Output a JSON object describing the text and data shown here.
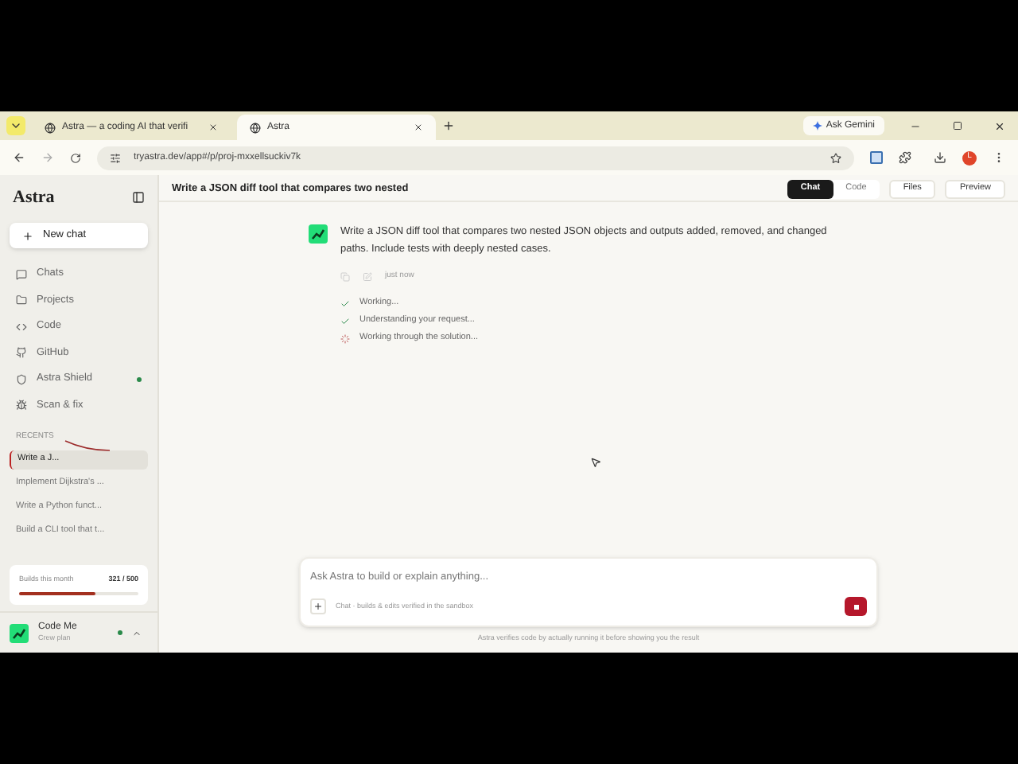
{
  "browser": {
    "tabs": [
      {
        "title": "Astra — a coding AI that verifi",
        "selected": false
      },
      {
        "title": "Astra",
        "selected": true
      }
    ],
    "ask_button": "Ask Gemini",
    "url": "tryastra.dev/app#/p/proj-mxxellsuckiv7k",
    "profile_initial": "L"
  },
  "sidebar": {
    "logo": "Astra",
    "new_chat": "New chat",
    "nav": [
      {
        "label": "Chats",
        "status_dot": false
      },
      {
        "label": "Projects",
        "status_dot": false
      },
      {
        "label": "Code",
        "status_dot": false
      },
      {
        "label": "GitHub",
        "status_dot": false
      },
      {
        "label": "Astra Shield",
        "status_dot": true
      },
      {
        "label": "Scan & fix",
        "status_dot": false
      }
    ],
    "recents_heading": "RECENTS",
    "recents": [
      {
        "label": "Write a J...",
        "selected": true
      },
      {
        "label": "Implement Dijkstra's ...",
        "selected": false
      },
      {
        "label": "Write a Python funct...",
        "selected": false
      },
      {
        "label": "Build a CLI tool that t...",
        "selected": false
      }
    ],
    "usage": {
      "label": "Builds this month",
      "count": "321 / 500",
      "level": 0.642
    },
    "user": {
      "name": "Code Me",
      "plan": "Crew plan",
      "online": true
    }
  },
  "header": {
    "title": "Write a JSON diff tool that compares two nested",
    "view_tabs": [
      {
        "label": "Chat",
        "selected": true
      },
      {
        "label": "Code",
        "selected": false
      }
    ],
    "buttons": [
      "Files",
      "Preview"
    ]
  },
  "message": {
    "text": "Write a JSON diff tool that compares two nested JSON objects and outputs added, removed, and changed paths. Include tests with deeply nested cases.",
    "time": "just now"
  },
  "steps": [
    {
      "label": "Working...",
      "kind": "done"
    },
    {
      "label": "Understanding your request...",
      "kind": "done"
    },
    {
      "label": "Working through the solution...",
      "kind": "running"
    }
  ],
  "composer": {
    "placeholder": "Ask Astra to build or explain anything...",
    "mode": "Chat · builds & edits verified in the sandbox"
  },
  "footer": "Astra verifies code by actually running it before showing you the result"
}
